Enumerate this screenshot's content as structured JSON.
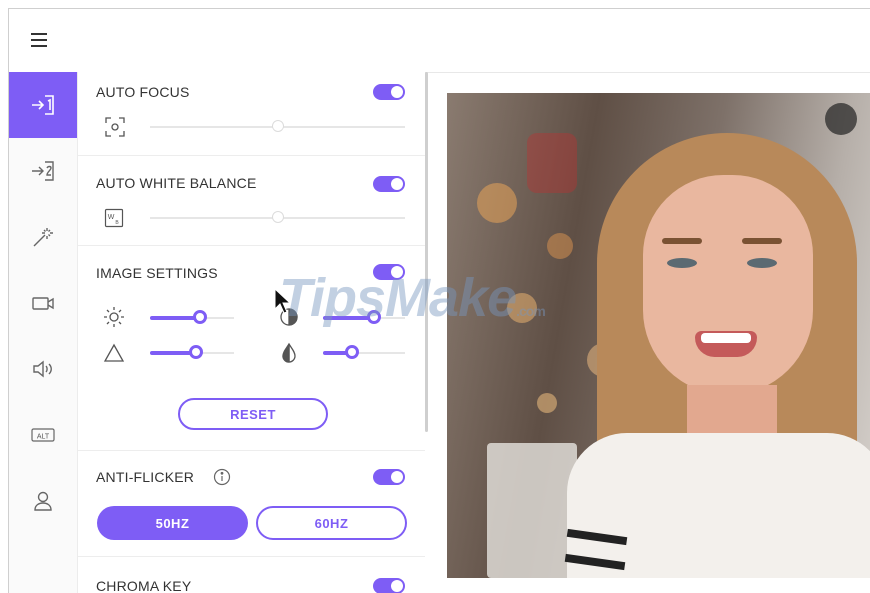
{
  "app": {
    "menu_icon": "hamburger-icon"
  },
  "sidebar": {
    "items": [
      {
        "name": "input-1",
        "icon": "input-1-icon",
        "active": true
      },
      {
        "name": "input-2",
        "icon": "input-2-icon",
        "active": false
      },
      {
        "name": "effects",
        "icon": "magic-wand-icon",
        "active": false
      },
      {
        "name": "camera",
        "icon": "camera-icon",
        "active": false
      },
      {
        "name": "audio",
        "icon": "speaker-icon",
        "active": false
      },
      {
        "name": "alt",
        "icon": "alt-icon",
        "label": "ALT",
        "active": false
      },
      {
        "name": "account",
        "icon": "user-icon",
        "active": false
      }
    ]
  },
  "panel": {
    "auto_focus": {
      "title": "AUTO FOCUS",
      "enabled": true,
      "slider_value": 0.5
    },
    "auto_white_balance": {
      "title": "AUTO WHITE BALANCE",
      "enabled": true,
      "slider_value": 0.5,
      "icon_label": "W"
    },
    "image_settings": {
      "title": "IMAGE SETTINGS",
      "enabled": true,
      "brightness": 0.6,
      "saturation": 0.7,
      "contrast": 0.55,
      "sharpness": 0.35,
      "reset_label": "RESET"
    },
    "anti_flicker": {
      "title": "ANTI-FLICKER",
      "enabled": true,
      "option_50": "50HZ",
      "option_60": "60HZ",
      "selected": "50HZ"
    },
    "chroma_key": {
      "title": "CHROMA KEY",
      "enabled": true
    }
  },
  "watermark": {
    "text": "TipsMake",
    "suffix": ".com"
  },
  "colors": {
    "accent": "#7e5df5"
  }
}
